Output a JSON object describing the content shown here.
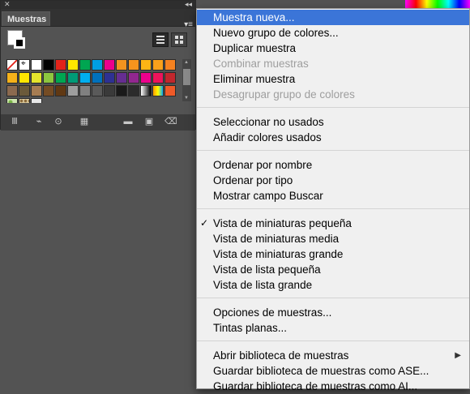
{
  "panel": {
    "tab_label": "Muestras",
    "footer_icons": [
      "swatch-libraries-icon",
      "show-kinds-icon",
      "swatch-options-icon",
      "color-group-icon",
      "new-color-group-icon",
      "new-swatch-icon",
      "delete-swatch-icon"
    ]
  },
  "swatches": {
    "colors": [
      [
        "none",
        "registration",
        "#ffffff",
        "#000000",
        "#e2231a",
        "#ffe600",
        "#00a651",
        "#009fe3",
        "#ec008c",
        "#f2931f",
        "#f7941d",
        "#fdb515",
        "#f9a01b",
        "#f58220"
      ],
      [
        "#f5b21a",
        "#ffe600",
        "#e4e42c",
        "#8dc63f",
        "#00a651",
        "#009b77",
        "#00aeef",
        "#0071bc",
        "#2e3192",
        "#662d91",
        "#92278f",
        "#ec008c",
        "#ed145b",
        "#c1272d"
      ],
      [
        "#8b6a4f",
        "#6b5a3a",
        "#a67c52",
        "#754c24",
        "#603813",
        "#9e9e9e",
        "#808080",
        "#5a5a5a",
        "#3a3a3a",
        "#1a1a1a",
        "#2b2b2b",
        "gradient-bw",
        "gradient-color",
        "#f05a28"
      ],
      [
        "pattern-leaves",
        "pattern-dots",
        "#e8e8e8"
      ]
    ]
  },
  "menu": {
    "items": [
      {
        "label": "Muestra nueva...",
        "state": "highlighted"
      },
      {
        "label": "Nuevo grupo de colores...",
        "state": "enabled"
      },
      {
        "label": "Duplicar muestra",
        "state": "enabled"
      },
      {
        "label": "Combinar muestras",
        "state": "disabled"
      },
      {
        "label": "Eliminar muestra",
        "state": "enabled"
      },
      {
        "label": "Desagrupar grupo de colores",
        "state": "disabled"
      },
      {
        "label": "Seleccionar no usados",
        "state": "enabled"
      },
      {
        "label": "Añadir colores usados",
        "state": "enabled"
      },
      {
        "label": "Ordenar por nombre",
        "state": "enabled"
      },
      {
        "label": "Ordenar por tipo",
        "state": "enabled"
      },
      {
        "label": "Mostrar campo Buscar",
        "state": "enabled"
      },
      {
        "label": "Vista de miniaturas pequeña",
        "state": "checked"
      },
      {
        "label": "Vista de miniaturas media",
        "state": "enabled"
      },
      {
        "label": "Vista de miniaturas grande",
        "state": "enabled"
      },
      {
        "label": "Vista de lista pequeña",
        "state": "enabled"
      },
      {
        "label": "Vista de lista grande",
        "state": "enabled"
      },
      {
        "label": "Opciones de muestras...",
        "state": "enabled"
      },
      {
        "label": "Tintas planas...",
        "state": "enabled"
      },
      {
        "label": "Abrir biblioteca de muestras",
        "state": "submenu"
      },
      {
        "label": "Guardar biblioteca de muestras como ASE...",
        "state": "enabled"
      },
      {
        "label": "Guardar biblioteca de muestras como AI...",
        "state": "enabled"
      }
    ],
    "checkmark": "✓",
    "submenu_arrow": "▶"
  },
  "colors": {
    "highlight": "#3b75d8",
    "panel_bg": "#535353",
    "menu_bg": "#f0f0f0"
  }
}
